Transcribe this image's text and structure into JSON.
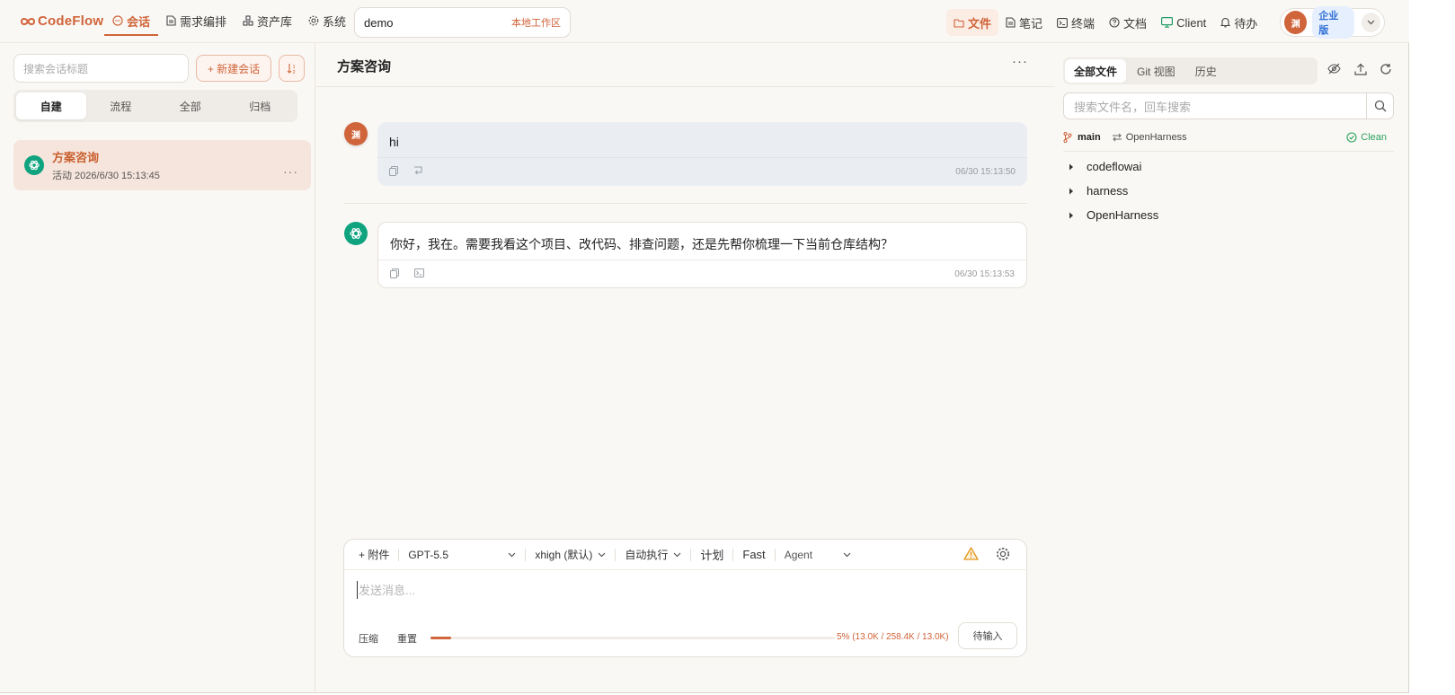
{
  "app": {
    "logo_text": "CodeFlow",
    "nav": [
      {
        "label": "会话",
        "icon": "chat-icon",
        "active": true
      },
      {
        "label": "需求编排",
        "icon": "document-icon"
      },
      {
        "label": "资产库",
        "icon": "asset-icon"
      },
      {
        "label": "系统",
        "icon": "gear-icon"
      }
    ],
    "workspace": {
      "name": "demo",
      "tag": "本地工作区"
    },
    "tools": [
      {
        "label": "文件",
        "icon": "folder-icon",
        "active": true
      },
      {
        "label": "笔记",
        "icon": "note-icon"
      },
      {
        "label": "终端",
        "icon": "terminal-icon"
      },
      {
        "label": "文档",
        "icon": "help-icon"
      },
      {
        "label": "Client",
        "icon": "monitor-icon"
      },
      {
        "label": "待办",
        "icon": "bell-icon"
      }
    ],
    "user": {
      "avatar_text": "渊",
      "edition": "企业版"
    }
  },
  "sidebar": {
    "search_placeholder": "搜索会话标题",
    "new_button": "+ 新建会话",
    "segments": [
      "自建",
      "流程",
      "全部",
      "归档"
    ],
    "active_segment": 0,
    "conversations": [
      {
        "title": "方案咨询",
        "meta": "活动 2026/6/30 15:13:45"
      }
    ]
  },
  "chat": {
    "title": "方案咨询",
    "messages": [
      {
        "role": "user",
        "avatar": "渊",
        "text": "hi",
        "time": "06/30 15:13:50"
      },
      {
        "role": "assistant",
        "text": "你好，我在。需要我看这个项目、改代码、排查问题，还是先帮你梳理一下当前仓库结构？",
        "time": "06/30 15:13:53"
      }
    ],
    "composer": {
      "attach": "+ 附件",
      "model": "GPT-5.5",
      "effort": "xhigh (默认)",
      "exec_mode": "自动执行",
      "plan": "计划",
      "fast": "Fast",
      "agent": "Agent",
      "placeholder": "发送消息...",
      "compress": "压缩",
      "reset": "重置",
      "context_fraction": 0.05,
      "context_text": "5% (13.0K / 258.4K / 13.0K)",
      "send": "待输入"
    }
  },
  "files": {
    "tabs": [
      "全部文件",
      "Git 视图",
      "历史"
    ],
    "active_tab": 0,
    "search_placeholder": "搜索文件名，回车搜索",
    "branch": "main",
    "repo": "OpenHarness",
    "status": "Clean",
    "tree": [
      "codeflowai",
      "harness",
      "OpenHarness"
    ]
  },
  "colors": {
    "accent": "#d0643a",
    "gpt_green": "#10a37f",
    "clean_green": "#2aa35a",
    "edition_blue": "#2f6fd6"
  }
}
